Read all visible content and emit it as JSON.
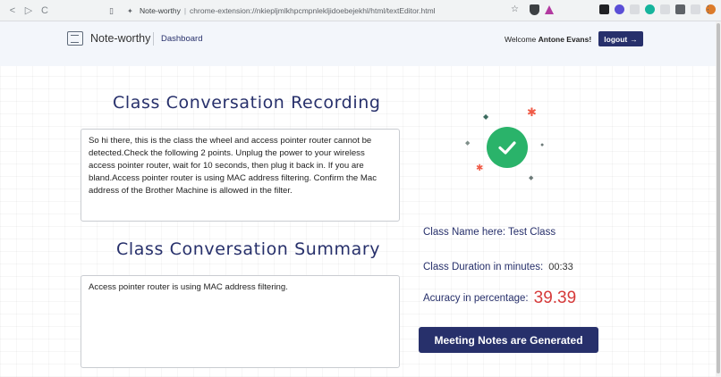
{
  "browser": {
    "page_title": "Note-worthy",
    "separator": "|",
    "url": "chrome-extension://nkiepljmlkhpcmpnlekljidoebejekhl/html/textEditor.html",
    "back_icon": "<",
    "forward_icon": "▷",
    "reload_icon": "C"
  },
  "header": {
    "brand": "Note-worthy",
    "nav_dashboard": "Dashboard",
    "welcome_prefix": "Welcome",
    "user_name": "Antone Evans!",
    "logout_label": "logout",
    "logout_arrow": "→"
  },
  "recording": {
    "title": "Class Conversation Recording",
    "text": "So hi there, this is the class the wheel and access pointer router cannot be detected.Check the following 2 points. Unplug the power to your wireless access pointer router, wait for 10 seconds, then plug it back in. If you are bland.Access pointer router is using MAC address filtering. Confirm the Mac address of the Brother Machine is allowed in the filter."
  },
  "summary": {
    "title": "Class Conversation Summary",
    "text": "Access pointer router is using MAC address filtering."
  },
  "status_icon": "check-circle-icon",
  "class_info": {
    "name_label": "Class Name here: Test Class",
    "duration_label": "Class Duration in minutes:",
    "duration_value": "00:33",
    "accuracy_label": "Acuracy in percentage:",
    "accuracy_value": "39.39"
  },
  "generated_button": "Meeting Notes are Generated",
  "colors": {
    "primary": "#27306b",
    "success": "#2ab36a",
    "accuracy": "#d63a3a"
  }
}
